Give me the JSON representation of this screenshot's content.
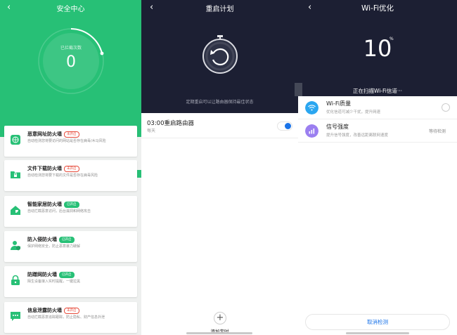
{
  "colors": {
    "green": "#27c076",
    "dark": "#1c1f33",
    "blue": "#1a73e8",
    "red": "#e74c3c",
    "purple": "#9b7ff0"
  },
  "security": {
    "title": "安全中心",
    "back_icon": "chevron-left-icon",
    "blocked_label": "已拦截次数",
    "blocked_count": "0",
    "cards": [
      {
        "icon": "globe-shield-icon",
        "title": "恶意网址防火墙",
        "badge": "未开启",
        "status": "off",
        "desc": "自动检测您将要访问的网站是否存在病毒/木马风险"
      },
      {
        "icon": "folder-lock-icon",
        "title": "文件下载防火墙",
        "badge": "未开启",
        "status": "off",
        "desc": "自动检测您将要下载的文件是否存在病毒风险"
      },
      {
        "icon": "smart-home-icon",
        "title": "智能家居防火墙",
        "badge": "已开启",
        "status": "on",
        "desc": "自动拦截恶意访问，后台漏洞和网络攻击"
      },
      {
        "icon": "user-shield-icon",
        "title": "防入侵防火墙",
        "badge": "已开启",
        "status": "on",
        "desc": "保护网络安全，防止恶意暴力破解"
      },
      {
        "icon": "lock-icon",
        "title": "防蹭网防火墙",
        "badge": "已开启",
        "status": "on",
        "desc": "陌生设备接入实时提醒，一键拉黑"
      },
      {
        "icon": "chat-bubble-icon",
        "title": "信息泄露防火墙",
        "badge": "未开启",
        "status": "off",
        "desc": "自动拦截恶意追踪跟踪，防止隐私、财产信息外泄"
      }
    ]
  },
  "restart": {
    "title": "重启计划",
    "back_icon": "chevron-left-icon",
    "timer_icon": "stopwatch-refresh-icon",
    "hint": "定期重启可以让路由器保持最佳状态",
    "schedule_time": "03:00重启路由器",
    "schedule_repeat": "每天",
    "toggle_on": true,
    "add_icon": "plus-icon",
    "add_label": "添加定时"
  },
  "wifi": {
    "title": "Wi-Fi优化",
    "back_icon": "chevron-left-icon",
    "percent": "10",
    "percent_sign": "%",
    "scan_text": "正在扫描Wi-Fi信道···",
    "items": [
      {
        "icon": "wifi-icon",
        "title": "Wi-Fi质量",
        "desc": "优化信道可减少干扰，提升网速"
      },
      {
        "icon": "signal-bars-icon",
        "title": "信号强度",
        "desc": "提升信号强度，改善远距离联网速度",
        "status": "等待检测"
      }
    ],
    "cancel_label": "取消检测"
  }
}
